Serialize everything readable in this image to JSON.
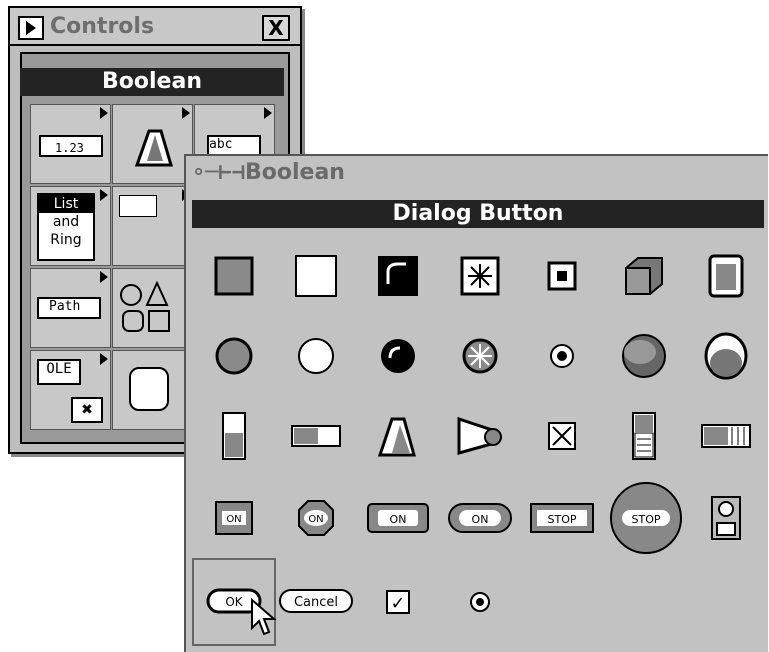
{
  "controls_window": {
    "title": "Controls",
    "close_glyph": "X",
    "palette_title": "Boolean",
    "cells": {
      "numeric": "1.23",
      "string": "abc",
      "list": "List",
      "and": "and",
      "ring": "Ring",
      "path": "Path",
      "ole": "OLE"
    }
  },
  "boolean_palette": {
    "title": "Boolean",
    "subpalette_label": "Dialog Button",
    "ok_label": "OK",
    "cancel_label": "Cancel",
    "on_label": "ON",
    "stop_label": "STOP",
    "check_glyph": "✓"
  }
}
